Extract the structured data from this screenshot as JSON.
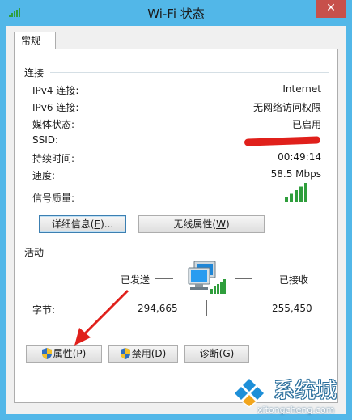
{
  "window": {
    "title": "Wi-Fi 状态",
    "close_glyph": "✕"
  },
  "tabs": [
    {
      "label": "常规",
      "selected": true
    }
  ],
  "connection": {
    "group_label": "连接",
    "rows": [
      {
        "label": "IPv4 连接:",
        "value": "Internet"
      },
      {
        "label": "IPv6 连接:",
        "value": "无网络访问权限"
      },
      {
        "label": "媒体状态:",
        "value": "已启用"
      },
      {
        "label": "SSID:",
        "value": ""
      },
      {
        "label": "持续时间:",
        "value": "00:49:14"
      },
      {
        "label": "速度:",
        "value": "58.5 Mbps"
      }
    ],
    "signal_label": "信号质量:",
    "signal_level_bars": 5,
    "signal_total_bars": 5,
    "details_button": {
      "text": "详细信息(",
      "key": "E",
      "suffix": ")..."
    },
    "wireless_props_button": {
      "text": "无线属性(",
      "key": "W",
      "suffix": ")"
    }
  },
  "activity": {
    "group_label": "活动",
    "sent_label": "已发送",
    "received_label": "已接收",
    "bytes_label": "字节:",
    "bytes_sent": "294,665",
    "bytes_received": "255,450"
  },
  "buttons": {
    "properties": {
      "text": "属性(",
      "key": "P",
      "suffix": ")"
    },
    "disable": {
      "text": "禁用(",
      "key": "D",
      "suffix": ")"
    },
    "diagnose": {
      "text": "诊断(",
      "key": "G",
      "suffix": ")"
    }
  },
  "watermark": {
    "title": "系统城",
    "url": "xitongcheng.com"
  },
  "colors": {
    "titlebar": "#52b7e8",
    "close_button": "#c7504b",
    "signal_green": "#2f9e3c",
    "annotation_arrow": "#e0201b"
  },
  "icons": [
    "wifi-signal-icon",
    "network-computers-icon",
    "uac-shield-icon",
    "red-arrow-annotation",
    "xitongcheng-logo-icon"
  ]
}
